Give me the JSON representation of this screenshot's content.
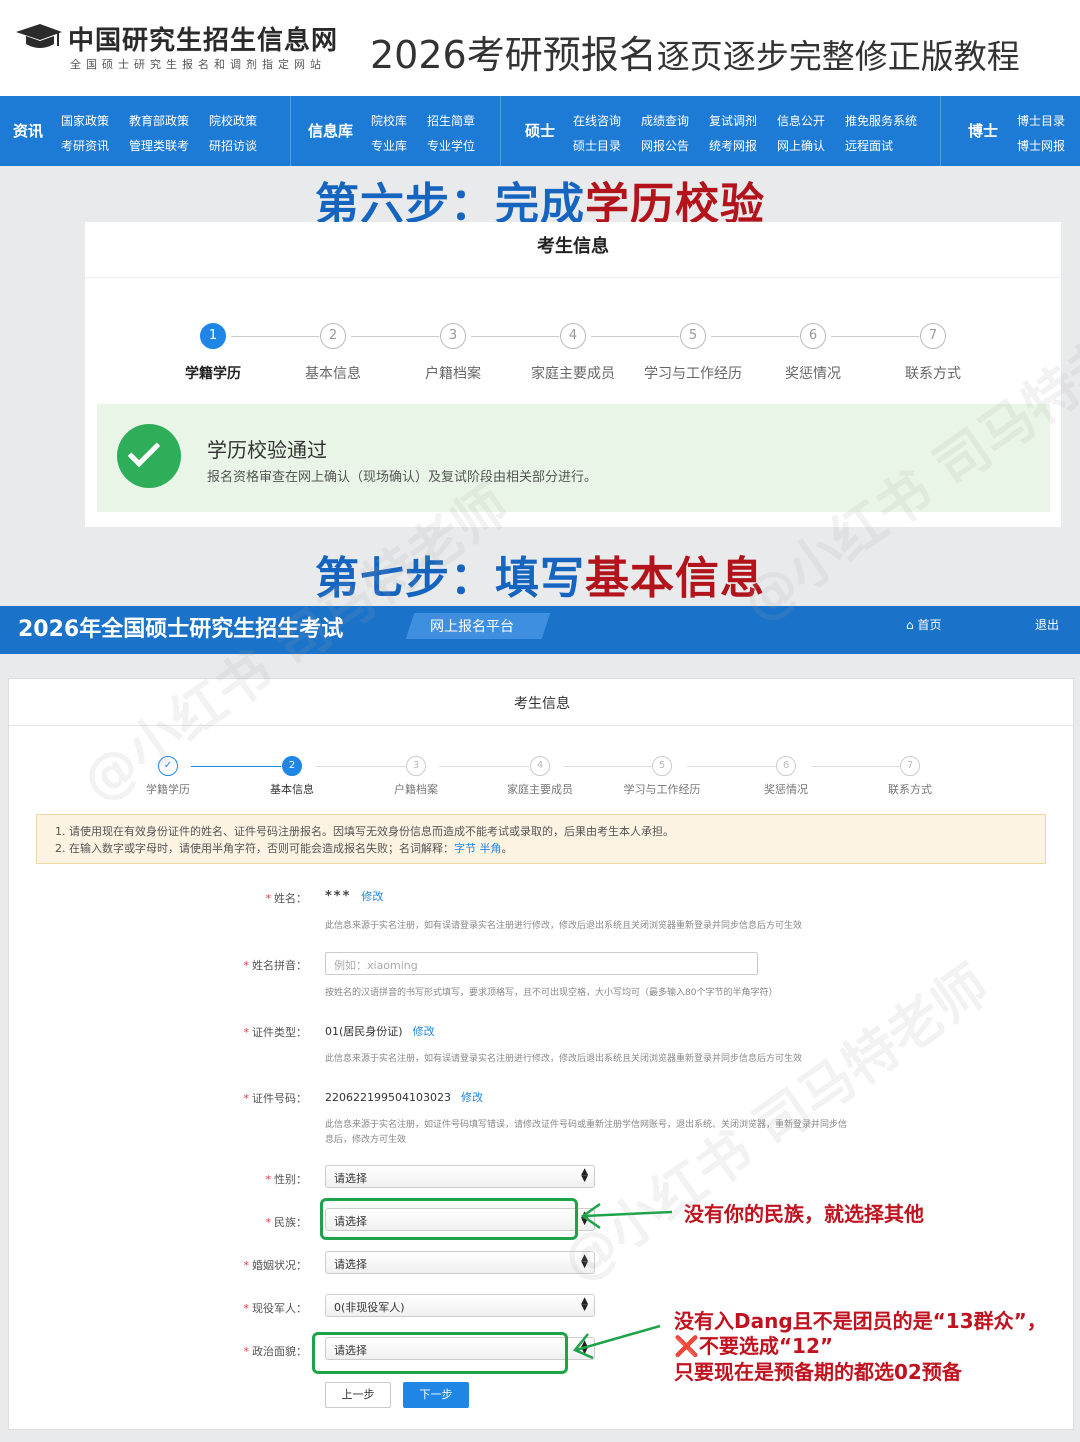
{
  "header": {
    "site_name": "中国研究生招生信息网",
    "site_subtitle": "全国硕士研究生报名和调剂指定网站",
    "headline_main": "2026考研预报名",
    "headline_rest": "逐页逐步完整修正版教程"
  },
  "nav": {
    "sections": [
      "资讯",
      "信息库",
      "硕士",
      "博士"
    ],
    "zixun_links": [
      "国家政策",
      "教育部政策",
      "院校政策",
      "考研资讯",
      "管理类联考",
      "研招访谈"
    ],
    "xinxiku_links": [
      "院校库",
      "招生简章",
      "专业库",
      "专业学位"
    ],
    "shuoshi_links": [
      "在线咨询",
      "成绩查询",
      "复试调剂",
      "信息公开",
      "推免服务系统",
      "硕士目录",
      "网报公告",
      "统考网报",
      "网上确认",
      "远程面试"
    ],
    "boshi_links": [
      "博士目录",
      "博士网报"
    ]
  },
  "step6": {
    "prefix": "第六步：",
    "blue": "完成",
    "red": "学历校验"
  },
  "panel1": {
    "title": "考生信息",
    "steps": [
      "学籍学历",
      "基本信息",
      "户籍档案",
      "家庭主要成员",
      "学习与工作经历",
      "奖惩情况",
      "联系方式"
    ],
    "step_numbers": [
      "1",
      "2",
      "3",
      "4",
      "5",
      "6",
      "7"
    ],
    "success_title": "学历校验通过",
    "success_desc": "报名资格审查在网上确认（现场确认）及复试阶段由相关部分进行。"
  },
  "step7": {
    "prefix": "第七步：",
    "blue": "填写",
    "red": "基本信息"
  },
  "platform": {
    "title": "2026年全国硕士研究生招生考试",
    "tag": "网上报名平台",
    "home": "首页",
    "exit": "退出"
  },
  "panel2": {
    "title": "考生信息",
    "steps": [
      "学籍学历",
      "基本信息",
      "户籍档案",
      "家庭主要成员",
      "学习与工作经历",
      "奖惩情况",
      "联系方式"
    ],
    "step_numbers": [
      "✓",
      "2",
      "3",
      "4",
      "5",
      "6",
      "7"
    ],
    "notice_line1": "1. 请使用现在有效身份证件的姓名、证件号码注册报名。因填写无效身份信息而造成不能考试或录取的，后果由考生本人承担。",
    "notice_line2": "2. 在输入数字或字母时，请使用半角字符，否则可能会造成报名失败；名词解释：",
    "notice_link": "字节 半角",
    "notice_end": "。"
  },
  "form": {
    "name_label": "姓名：",
    "name_value": "***",
    "edit": "修改",
    "name_hint": "此信息来源于实名注册，如有误请登录实名注册进行修改，修改后退出系统且关闭浏览器重新登录并同步信息后方可生效",
    "pinyin_label": "姓名拼音：",
    "pinyin_placeholder": "例如：xiaoming",
    "pinyin_hint": "按姓名的汉语拼音的书写形式填写，要求顶格写，且不可出现空格，大小写均可（最多输入80个字节的半角字符）",
    "idtype_label": "证件类型：",
    "idtype_value": "01(居民身份证)",
    "idtype_hint": "此信息来源于实名注册，如有误请登录实名注册进行修改，修改后退出系统且关闭浏览器重新登录并同步信息后方可生效",
    "idno_label": "证件号码：",
    "idno_value": "220622199504103023",
    "idno_hint1": "此信息来源于实名注册，如证件号码填写错误，请修改证件号码或重新注册学信网账号，退出系统、关闭浏览器，重新登录并同步信",
    "idno_hint2": "息后，修改方可生效",
    "gender_label": "性别：",
    "nation_label": "民族：",
    "marital_label": "婚姻状况：",
    "military_label": "现役军人：",
    "political_label": "政治面貌：",
    "select_placeholder": "请选择",
    "military_value": "0(非现役军人)",
    "prev": "上一步",
    "next": "下一步"
  },
  "annotations": {
    "nation_tip": "没有你的民族，就选择其他",
    "political_tip1": "没有入Dang且不是团员的是“13群众”，",
    "political_tip2": "❌不要选成“12”",
    "political_tip3": "只要现在是预备期的都选02预备"
  },
  "watermark": "@小红书 司马特老师",
  "colors": {
    "nav_blue": "#1d7bd6",
    "step_blue": "#1565c0",
    "step_red": "#b3141c",
    "annotation_red": "#c1121f",
    "highlight_green": "#1ea34a",
    "success_green": "#2fae5a"
  }
}
